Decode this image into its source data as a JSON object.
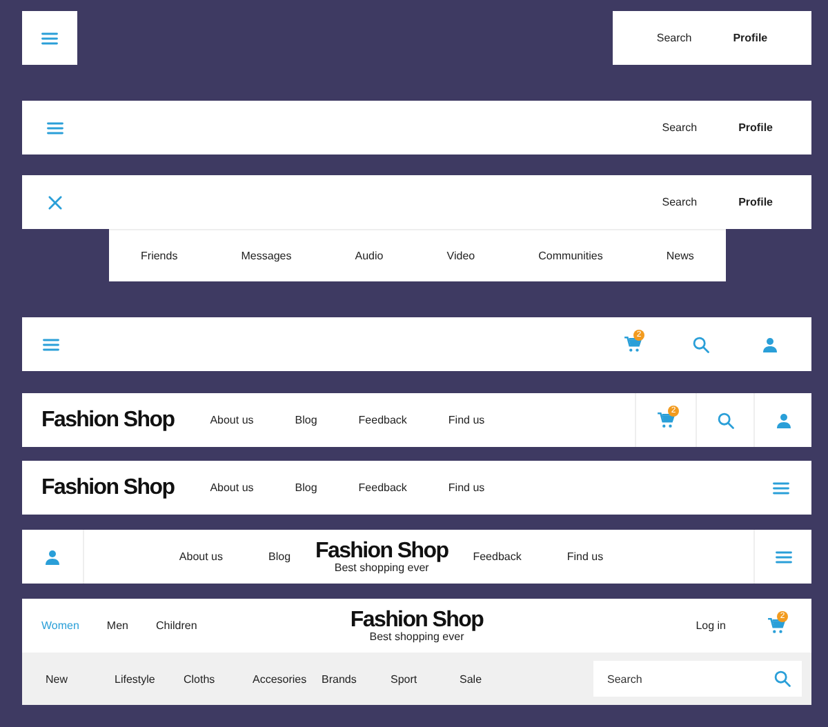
{
  "navbars": [
    {
      "kind": "split",
      "menu_open": false,
      "links": [
        {
          "label": "Search",
          "emphasized": false
        },
        {
          "label": "Profile",
          "emphasized": true
        }
      ]
    },
    {
      "kind": "bar",
      "menu_open": false,
      "links": [
        {
          "label": "Search",
          "emphasized": false
        },
        {
          "label": "Profile",
          "emphasized": true
        }
      ]
    },
    {
      "kind": "bar",
      "menu_open": true,
      "links": [
        {
          "label": "Search",
          "emphasized": false
        },
        {
          "label": "Profile",
          "emphasized": true
        }
      ],
      "submenu": [
        "Friends",
        "Messages",
        "Audio",
        "Video",
        "Communities",
        "News"
      ]
    },
    {
      "kind": "icons",
      "menu_open": false,
      "cart_badge": "2"
    },
    {
      "kind": "shop-icons",
      "logo": "Fashion Shop",
      "links": [
        "About us",
        "Blog",
        "Feedback",
        "Find us"
      ],
      "cart_badge": "2"
    },
    {
      "kind": "shop-menu",
      "menu_open": false,
      "logo": "Fashion Shop",
      "links": [
        "About us",
        "Blog",
        "Feedback",
        "Find us"
      ]
    },
    {
      "kind": "centered",
      "menu_open": false,
      "logo": "Fashion Shop",
      "tagline": "Best shopping ever",
      "links_left": [
        "About us",
        "Blog"
      ],
      "links_right": [
        "Feedback",
        "Find us"
      ]
    },
    {
      "kind": "store",
      "logo": "Fashion Shop",
      "tagline": "Best shopping ever",
      "sections": [
        {
          "label": "Women",
          "selected": true
        },
        {
          "label": "Men",
          "selected": false
        },
        {
          "label": "Children",
          "selected": false
        }
      ],
      "login": "Log in",
      "cart_badge": "2",
      "categories": [
        "New",
        "Lifestyle",
        "Cloths",
        "Accesories",
        "Brands",
        "Sport",
        "Sale"
      ],
      "search": {
        "placeholder": "Search"
      }
    }
  ]
}
